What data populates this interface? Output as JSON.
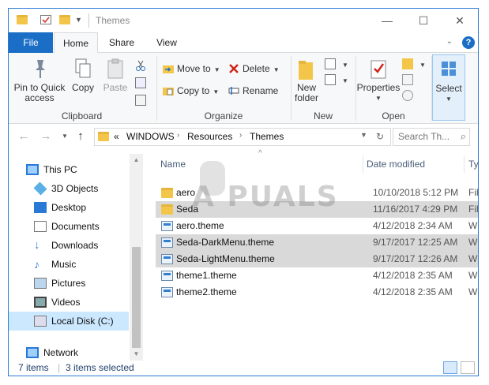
{
  "window": {
    "title": "Themes"
  },
  "window_controls": {
    "minimize": "—",
    "maximize": "☐",
    "close": "✕"
  },
  "ribbon_tabs": [
    "File",
    "Home",
    "Share",
    "View"
  ],
  "ribbon_toggle": "⌄",
  "help": "?",
  "ribbon": {
    "clipboard": {
      "label": "Clipboard",
      "pin_line1": "Pin to Quick",
      "pin_line2": "access",
      "copy": "Copy",
      "paste": "Paste"
    },
    "organize": {
      "label": "Organize",
      "move_to": "Move to",
      "delete": "Delete",
      "copy_to": "Copy to",
      "rename": "Rename"
    },
    "new": {
      "label": "New",
      "new_folder_line1": "New",
      "new_folder_line2": "folder"
    },
    "open": {
      "label": "Open",
      "properties": "Properties"
    },
    "select": {
      "label": "Select"
    }
  },
  "address": {
    "overflow": "«",
    "crumbs": [
      "WINDOWS",
      "Resources",
      "Themes"
    ]
  },
  "search": {
    "placeholder": "Search Th..."
  },
  "nav": {
    "this_pc": "This PC",
    "items": [
      "3D Objects",
      "Desktop",
      "Documents",
      "Downloads",
      "Music",
      "Pictures",
      "Videos",
      "Local Disk (C:)"
    ],
    "network": "Network"
  },
  "columns": {
    "name": "Name",
    "date_modified": "Date modified",
    "type": "Type"
  },
  "files": [
    {
      "name": "aero",
      "date": "10/10/2018 5:12 PM",
      "type": "File f",
      "kind": "folder",
      "selected": false
    },
    {
      "name": "Seda",
      "date": "11/16/2017 4:29 PM",
      "type": "File f",
      "kind": "folder",
      "selected": true
    },
    {
      "name": "aero.theme",
      "date": "4/12/2018 2:34 AM",
      "type": "Wind",
      "kind": "theme",
      "selected": false
    },
    {
      "name": "Seda-DarkMenu.theme",
      "date": "9/17/2017 12:25 AM",
      "type": "Wind",
      "kind": "theme",
      "selected": true
    },
    {
      "name": "Seda-LightMenu.theme",
      "date": "9/17/2017 12:26 AM",
      "type": "Wind",
      "kind": "theme",
      "selected": true
    },
    {
      "name": "theme1.theme",
      "date": "4/12/2018 2:35 AM",
      "type": "Wind",
      "kind": "theme",
      "selected": false
    },
    {
      "name": "theme2.theme",
      "date": "4/12/2018 2:35 AM",
      "type": "Wind",
      "kind": "theme",
      "selected": false
    }
  ],
  "status": {
    "items": "7 items",
    "selected": "3 items selected"
  },
  "watermark": "A  PUALS",
  "colors": {
    "accent": "#1a6ec6",
    "selection": "#d9d9d9",
    "nav_selection": "#cce8ff"
  }
}
